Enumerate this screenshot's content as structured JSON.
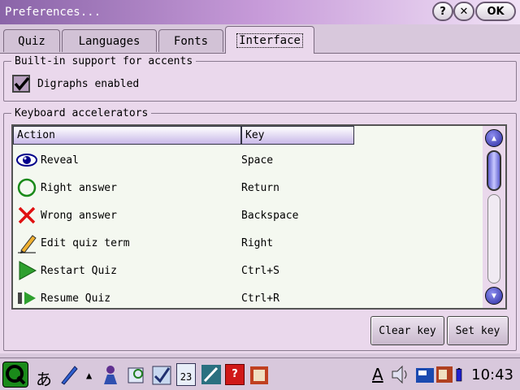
{
  "window": {
    "title": "Preferences..."
  },
  "window_buttons": {
    "help": "?",
    "close": "✕",
    "ok": "OK"
  },
  "tabs": [
    {
      "label": "Quiz"
    },
    {
      "label": "Languages"
    },
    {
      "label": "Fonts"
    },
    {
      "label": "Interface",
      "active": true
    }
  ],
  "accents_group": {
    "title": "Built-in support for accents",
    "digraphs_label": "Digraphs enabled",
    "digraphs_checked": true
  },
  "keyboard_group": {
    "title": "Keyboard accelerators"
  },
  "table": {
    "columns": [
      "Action",
      "Key"
    ],
    "rows": [
      {
        "action": "Reveal",
        "key": "Space",
        "icon": "eye-icon"
      },
      {
        "action": "Right answer",
        "key": "Return",
        "icon": "circle-icon"
      },
      {
        "action": "Wrong answer",
        "key": "Backspace",
        "icon": "cross-icon"
      },
      {
        "action": "Edit quiz term",
        "key": "Right",
        "icon": "pencil-icon"
      },
      {
        "action": "Restart Quiz",
        "key": "Ctrl+S",
        "icon": "play-icon"
      },
      {
        "action": "Resume Quiz",
        "key": "Ctrl+R",
        "icon": "resume-icon"
      }
    ]
  },
  "buttons": {
    "clear": "Clear key",
    "set": "Set key"
  },
  "taskbar": {
    "input_method": "あ",
    "font_label": "A",
    "calendar_day": "23",
    "help_icon": "?",
    "clock": "10:43"
  },
  "colors": {
    "titlebar_start": "#8a64a8",
    "panel": "#ead8ec",
    "list_bg": "#f4f8f0",
    "accent_blue": "#2a2aa0"
  }
}
